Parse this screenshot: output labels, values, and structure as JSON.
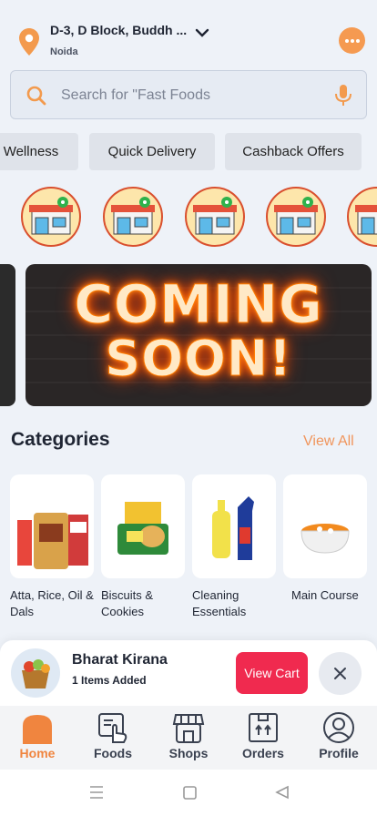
{
  "header": {
    "address": "D-3, D Block, Buddh ...",
    "city": "Noida",
    "icons": {
      "location": "location-pin-icon",
      "dropdown": "chevron-down-icon",
      "chat": "chat-bubble-icon"
    }
  },
  "search": {
    "placeholder": "Search for \"Fast Foods",
    "icons": {
      "search": "search-icon",
      "mic": "microphone-icon"
    }
  },
  "chips": [
    {
      "label": "Wellness"
    },
    {
      "label": "Quick Delivery"
    },
    {
      "label": "Cashback Offers"
    }
  ],
  "banner": {
    "line1": "COMING",
    "line2": "SOON!"
  },
  "categories": {
    "title": "Categories",
    "view_all": "View All",
    "items": [
      {
        "label": "Atta, Rice, Oil & Dals"
      },
      {
        "label": "Biscuits & Cookies"
      },
      {
        "label": "Cleaning Essentials"
      },
      {
        "label": "Main Course"
      }
    ]
  },
  "cart": {
    "shop_name": "Bharat Kirana",
    "items_added": "1 Items Added",
    "view_cart": "View Cart",
    "close_icon": "close-icon"
  },
  "nav": [
    {
      "label": "Home",
      "icon": "home-icon",
      "active": true
    },
    {
      "label": "Foods",
      "icon": "foods-icon"
    },
    {
      "label": "Shops",
      "icon": "shop-icon"
    },
    {
      "label": "Orders",
      "icon": "orders-icon"
    },
    {
      "label": "Profile",
      "icon": "profile-icon"
    }
  ],
  "colors": {
    "accent": "#f0853f",
    "cart_button": "#f02a4f",
    "background": "#eef2f8"
  }
}
